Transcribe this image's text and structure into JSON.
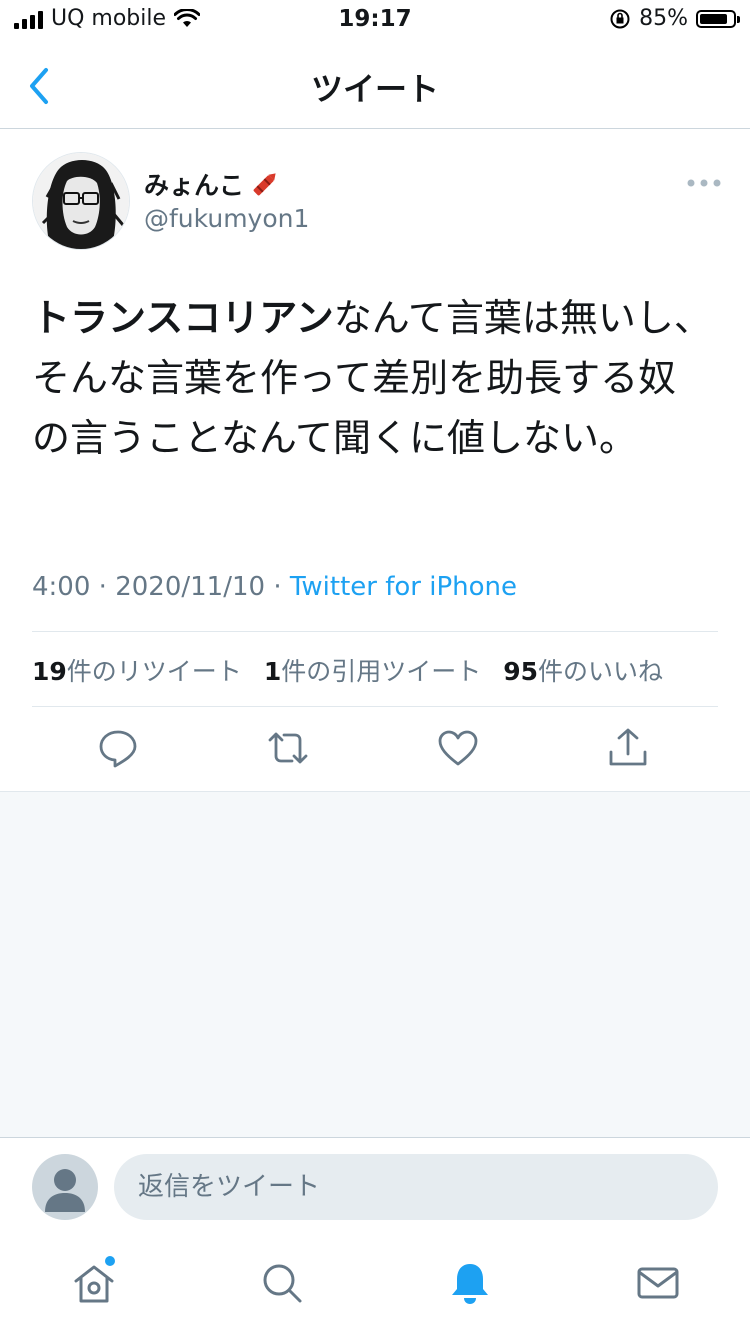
{
  "status_bar": {
    "carrier": "UQ mobile",
    "time": "19:17",
    "battery": "85%"
  },
  "nav": {
    "title": "ツイート"
  },
  "tweet": {
    "author_name": "みょんこ",
    "author_handle": "@fukumyon1",
    "text_bold": "トランスコリアン",
    "text_rest": "なんて言葉は無いし、そんな言葉を作って差別を助長する奴の言うことなんて聞くに値しない。",
    "time": "4:00",
    "date": "2020/11/10",
    "separator": "·",
    "client": "Twitter for iPhone"
  },
  "stats": {
    "retweets_count": "19",
    "retweets_label": "件のリツイート",
    "quotes_count": "1",
    "quotes_label": "件の引用ツイート",
    "likes_count": "95",
    "likes_label": "件のいいね"
  },
  "reply": {
    "placeholder": "返信をツイート"
  },
  "icons": {
    "back": "chevron-left-icon",
    "more": "more-icon",
    "reply": "reply-icon",
    "retweet": "retweet-icon",
    "like": "heart-icon",
    "share": "share-icon",
    "home": "home-icon",
    "search": "search-icon",
    "notifications": "bell-icon",
    "messages": "mail-icon"
  },
  "colors": {
    "accent": "#1da1f2",
    "secondary_text": "#657786",
    "background_gray": "#f5f8fa"
  }
}
